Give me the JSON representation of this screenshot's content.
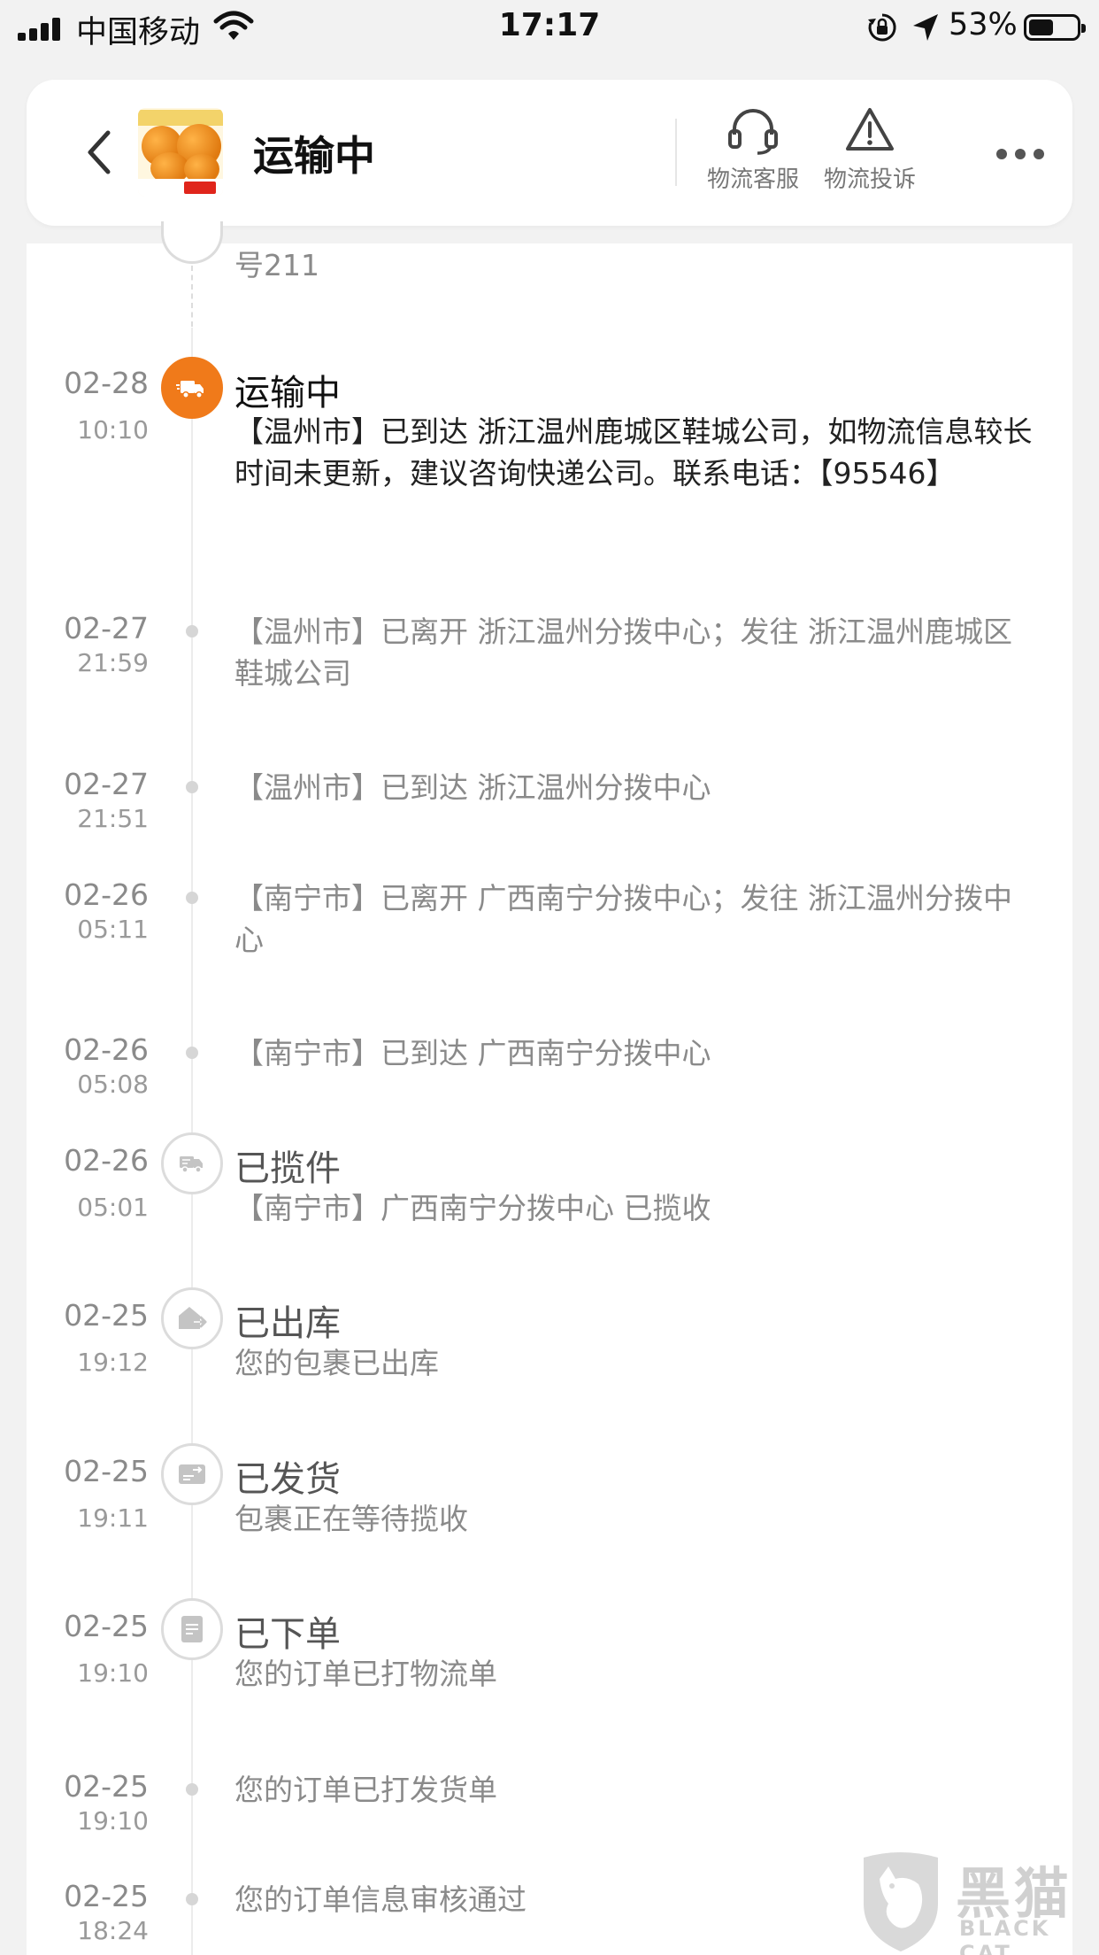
{
  "status_bar": {
    "carrier": "中国移动",
    "time": "17:17",
    "battery": "53%"
  },
  "header": {
    "title": "运输中",
    "actions": [
      {
        "label": "物流客服",
        "icon": "headset-icon"
      },
      {
        "label": "物流投诉",
        "icon": "warning-icon"
      }
    ]
  },
  "timeline": {
    "top_remainder": "号211",
    "entries": [
      {
        "date": "02-28",
        "time": "10:10",
        "title": "运输中",
        "desc": "【温州市】已到达 浙江温州鹿城区鞋城公司，如物流信息较长时间未更新，建议咨询快递公司。联系电话：【95546】",
        "icon": "truck-icon",
        "active": true
      },
      {
        "date": "02-27",
        "time": "21:59",
        "title": "",
        "desc": "【温州市】已离开 浙江温州分拨中心；发往 浙江温州鹿城区鞋城公司"
      },
      {
        "date": "02-27",
        "time": "21:51",
        "title": "",
        "desc": "【温州市】已到达 浙江温州分拨中心"
      },
      {
        "date": "02-26",
        "time": "05:11",
        "title": "",
        "desc": "【南宁市】已离开 广西南宁分拨中心；发往 浙江温州分拨中心"
      },
      {
        "date": "02-26",
        "time": "05:08",
        "title": "",
        "desc": "【南宁市】已到达 广西南宁分拨中心"
      },
      {
        "date": "02-26",
        "time": "05:01",
        "title": "已揽件",
        "desc": "【南宁市】广西南宁分拨中心 已揽收",
        "icon": "pickup-truck-icon"
      },
      {
        "date": "02-25",
        "time": "19:12",
        "title": "已出库",
        "desc": "您的包裹已出库",
        "icon": "warehouse-out-icon"
      },
      {
        "date": "02-25",
        "time": "19:11",
        "title": "已发货",
        "desc": "包裹正在等待揽收",
        "icon": "shipped-icon"
      },
      {
        "date": "02-25",
        "time": "19:10",
        "title": "已下单",
        "desc": "您的订单已打物流单",
        "icon": "order-icon"
      },
      {
        "date": "02-25",
        "time": "19:10",
        "title": "",
        "desc": "您的订单已打发货单"
      },
      {
        "date": "02-25",
        "time": "18:24",
        "title": "",
        "desc": "您的订单信息审核通过"
      }
    ]
  },
  "watermark": {
    "title": "黑猫",
    "subtitle": "BLACK CAT"
  },
  "colors": {
    "accent": "#f07a1a",
    "background": "#f2f2f2"
  }
}
